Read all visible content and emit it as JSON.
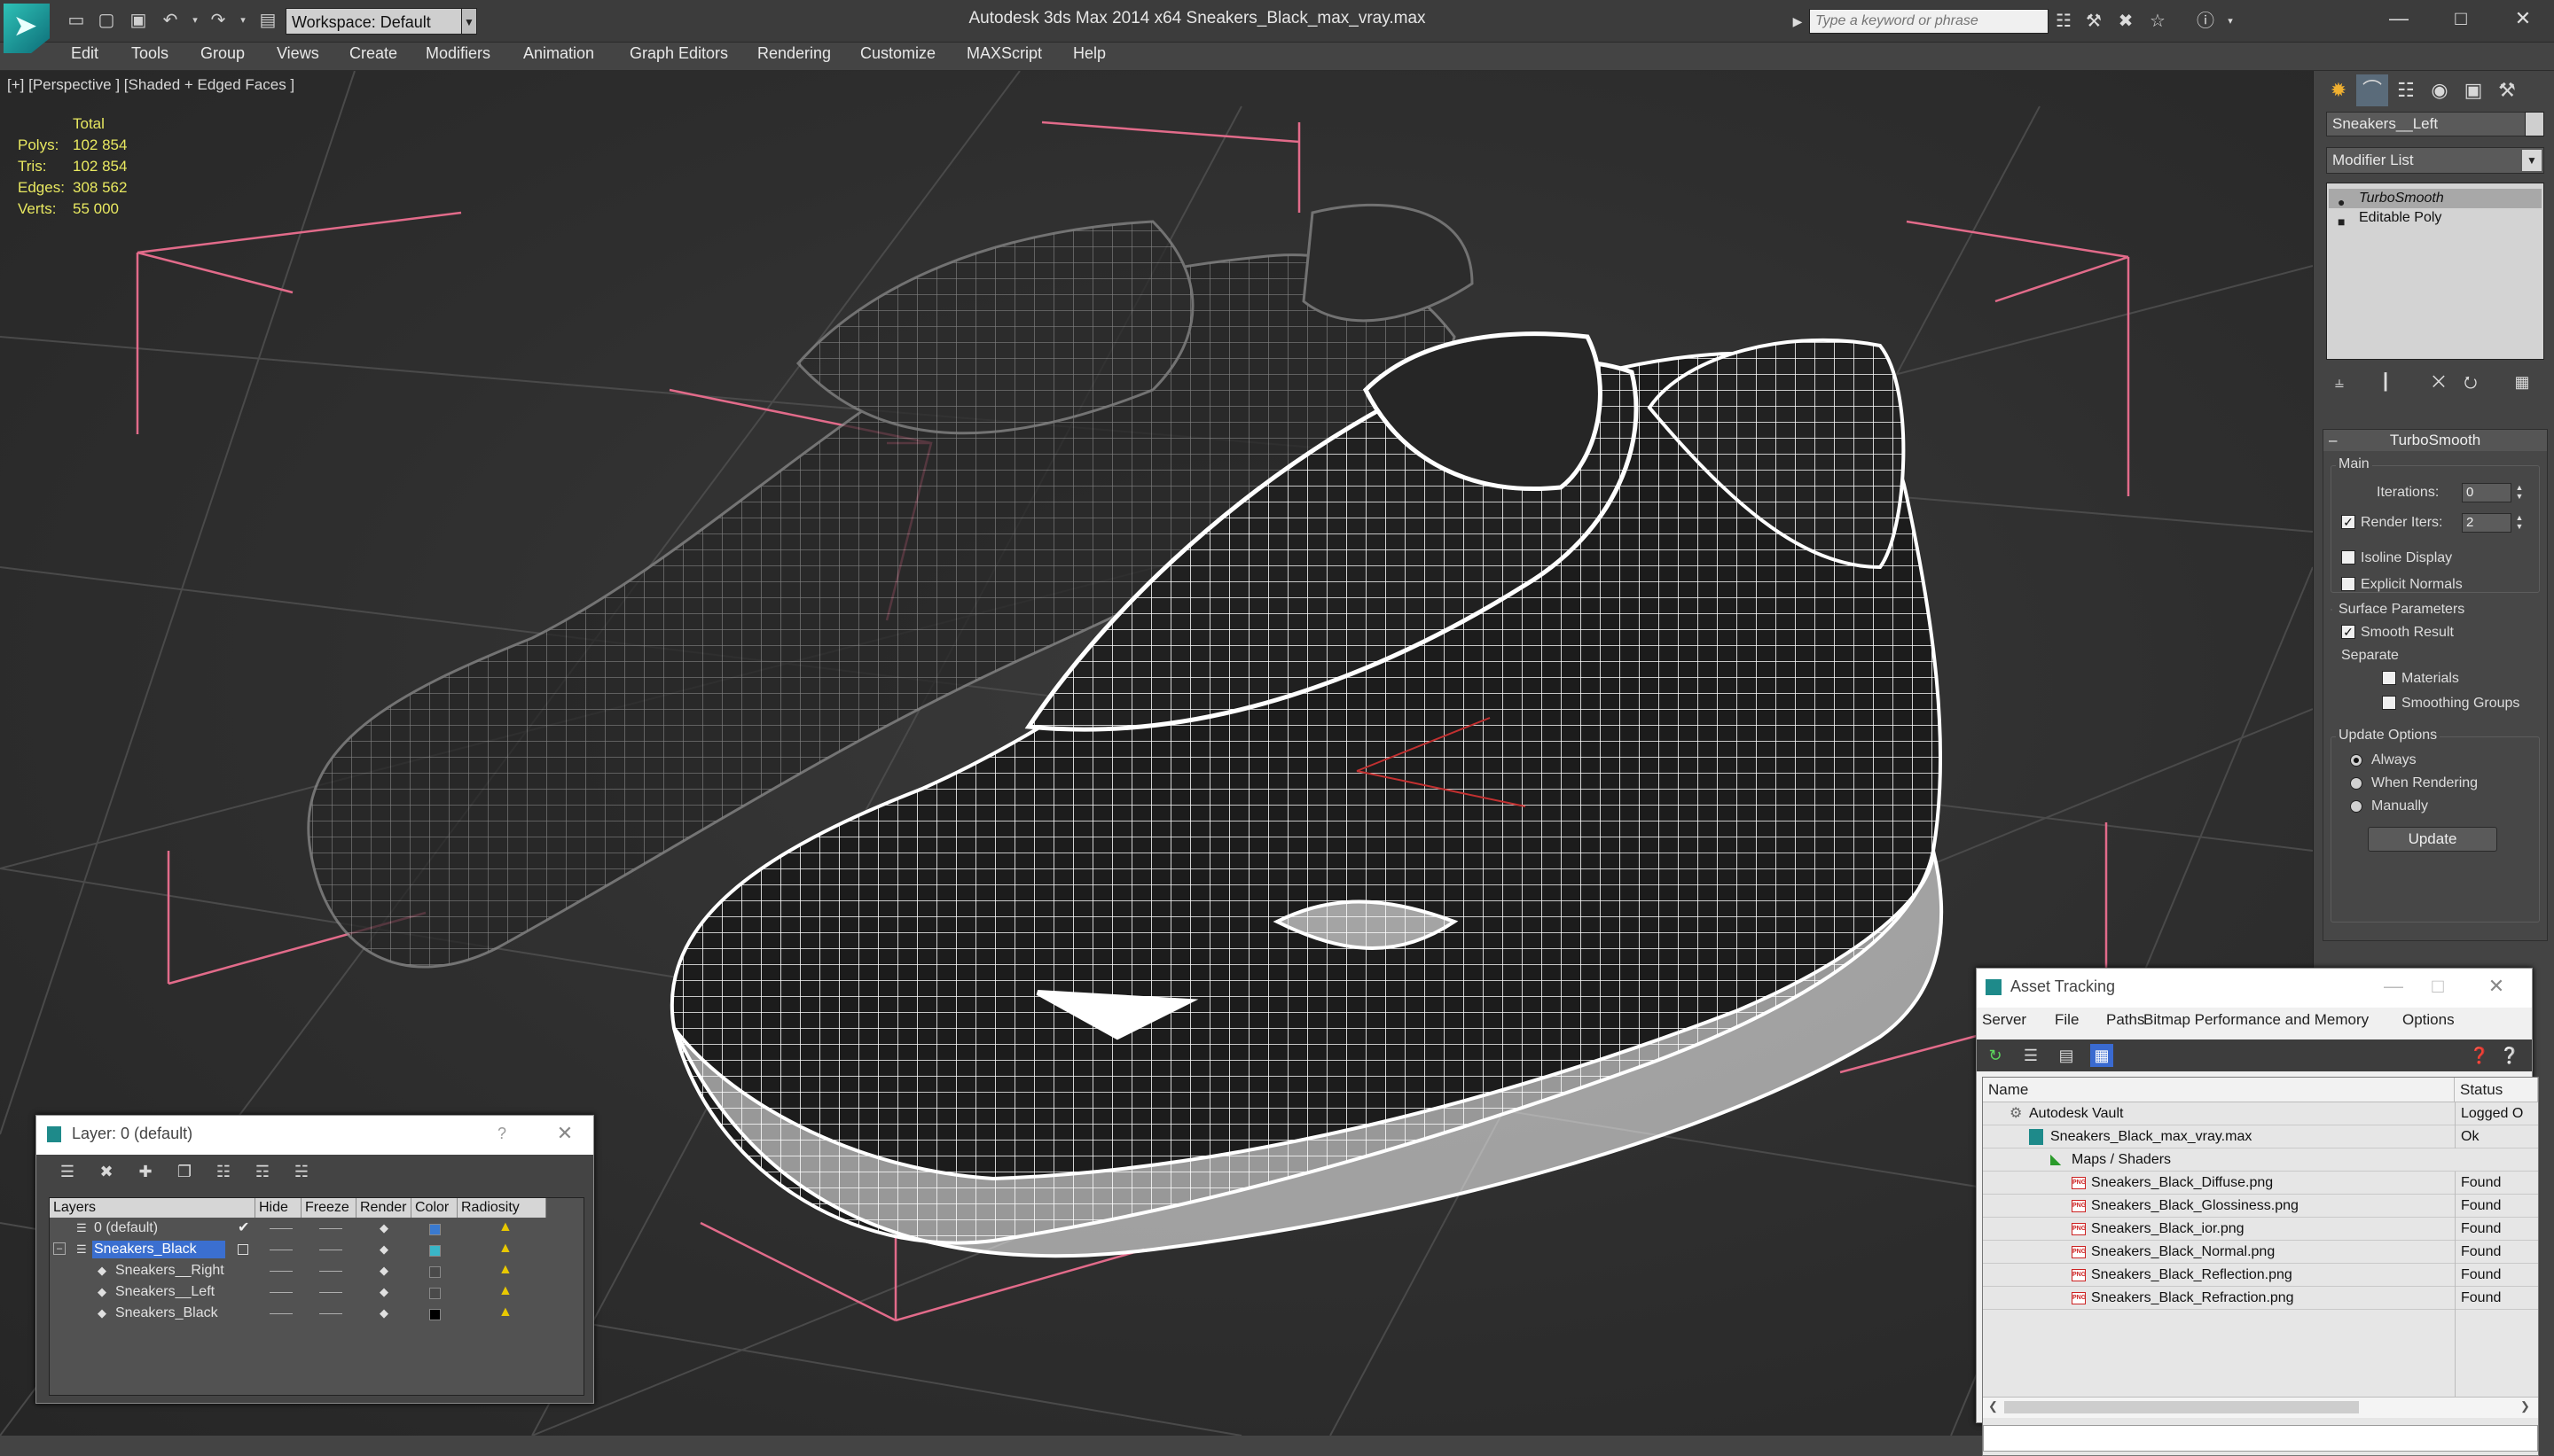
{
  "window": {
    "title": "Autodesk 3ds Max 2014 x64     Sneakers_Black_max_vray.max"
  },
  "workspace": {
    "label": "Workspace: Default"
  },
  "search": {
    "placeholder": "Type a keyword or phrase"
  },
  "menu": [
    "Edit",
    "Tools",
    "Group",
    "Views",
    "Create",
    "Modifiers",
    "Animation",
    "Graph Editors",
    "Rendering",
    "Customize",
    "MAXScript",
    "Help"
  ],
  "viewport": {
    "label": "[+] [Perspective ] [Shaded + Edged Faces ]",
    "stats": {
      "header": "Total",
      "polys_label": "Polys:",
      "polys": "102 854",
      "tris_label": "Tris:",
      "tris": "102 854",
      "edges_label": "Edges:",
      "edges": "308 562",
      "verts_label": "Verts:",
      "verts": "55 000"
    }
  },
  "command_panel": {
    "object_name": "Sneakers__Left",
    "modifier_list": "Modifier List",
    "stack": [
      "TurboSmooth",
      "Editable Poly"
    ],
    "rollout_title": "TurboSmooth",
    "main_group": "Main",
    "iterations_label": "Iterations:",
    "iterations": "0",
    "render_iters_label": "Render Iters:",
    "render_iters": "2",
    "isoline_label": "Isoline Display",
    "explicit_label": "Explicit Normals",
    "surface_group": "Surface Parameters",
    "smooth_label": "Smooth Result",
    "separate_label": "Separate",
    "materials_label": "Materials",
    "smoothing_label": "Smoothing Groups",
    "update_group": "Update Options",
    "always_label": "Always",
    "when_rendering_label": "When Rendering",
    "manually_label": "Manually",
    "update_button": "Update"
  },
  "layer_window": {
    "title": "Layer: 0 (default)",
    "help": "?",
    "columns": [
      "Layers",
      "Hide",
      "Freeze",
      "Render",
      "Color",
      "Radiosity"
    ],
    "rows": [
      {
        "name": "0 (default)",
        "color": "#3a7ad0"
      },
      {
        "name": "Sneakers_Black",
        "color": "#39b6c8"
      },
      {
        "name": "Sneakers__Right",
        "color": "#4a4a4a"
      },
      {
        "name": "Sneakers__Left",
        "color": "#4a4a4a"
      },
      {
        "name": "Sneakers_Black",
        "color": "#000000"
      }
    ]
  },
  "asset_tracking": {
    "title": "Asset Tracking",
    "menu": [
      "Server",
      "File",
      "Paths",
      "Bitmap Performance and Memory",
      "Options"
    ],
    "columns": {
      "name": "Name",
      "status": "Status"
    },
    "rows": [
      {
        "name": "Autodesk Vault",
        "status": "Logged O"
      },
      {
        "name": "Sneakers_Black_max_vray.max",
        "status": "Ok"
      },
      {
        "name": "Maps / Shaders",
        "status": ""
      },
      {
        "name": "Sneakers_Black_Diffuse.png",
        "status": "Found"
      },
      {
        "name": "Sneakers_Black_Glossiness.png",
        "status": "Found"
      },
      {
        "name": "Sneakers_Black_ior.png",
        "status": "Found"
      },
      {
        "name": "Sneakers_Black_Normal.png",
        "status": "Found"
      },
      {
        "name": "Sneakers_Black_Reflection.png",
        "status": "Found"
      },
      {
        "name": "Sneakers_Black_Refraction.png",
        "status": "Found"
      }
    ]
  }
}
